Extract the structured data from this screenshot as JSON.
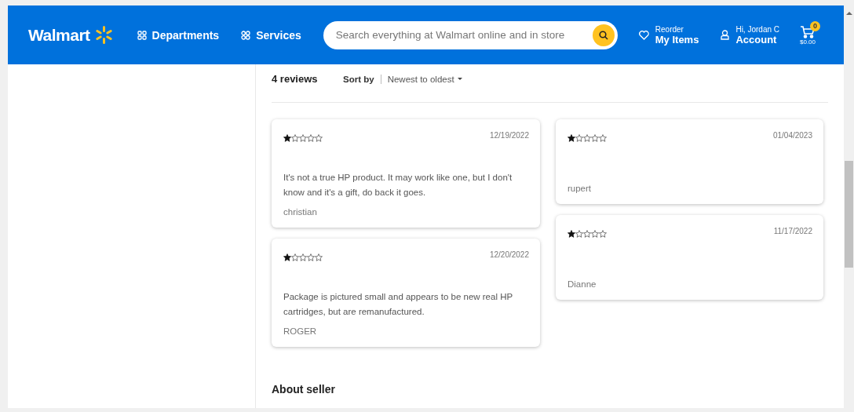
{
  "header": {
    "logo": "Walmart",
    "nav": [
      {
        "label": "Departments",
        "kind": "grid"
      },
      {
        "label": "Services",
        "kind": "services"
      }
    ],
    "search": {
      "placeholder": "Search everything at Walmart online and in store"
    },
    "reorder": {
      "caption": "Reorder",
      "label": "My Items"
    },
    "account": {
      "caption": "Hi, Jordan C",
      "label": "Account"
    },
    "cart": {
      "count": "0",
      "total": "$0.00"
    }
  },
  "reviews": {
    "count": "4 reviews",
    "sort_label": "Sort by",
    "sort_value": "Newest to oldest",
    "columns": [
      [
        {
          "stars": 1,
          "date": "12/19/2022",
          "text": "It's not a true HP product. It may work like one, but I don't know and it's a gift, do back it goes.",
          "author": "christian"
        },
        {
          "stars": 1,
          "date": "12/20/2022",
          "text": "Package is pictured small and appears to be new real HP cartridges, but are remanufactured.",
          "author": "ROGER"
        }
      ],
      [
        {
          "stars": 1,
          "date": "01/04/2023",
          "author": "rupert"
        },
        {
          "stars": 1,
          "date": "11/17/2022",
          "author": "Dianne"
        }
      ]
    ]
  },
  "next_section": {
    "title": "About seller"
  }
}
